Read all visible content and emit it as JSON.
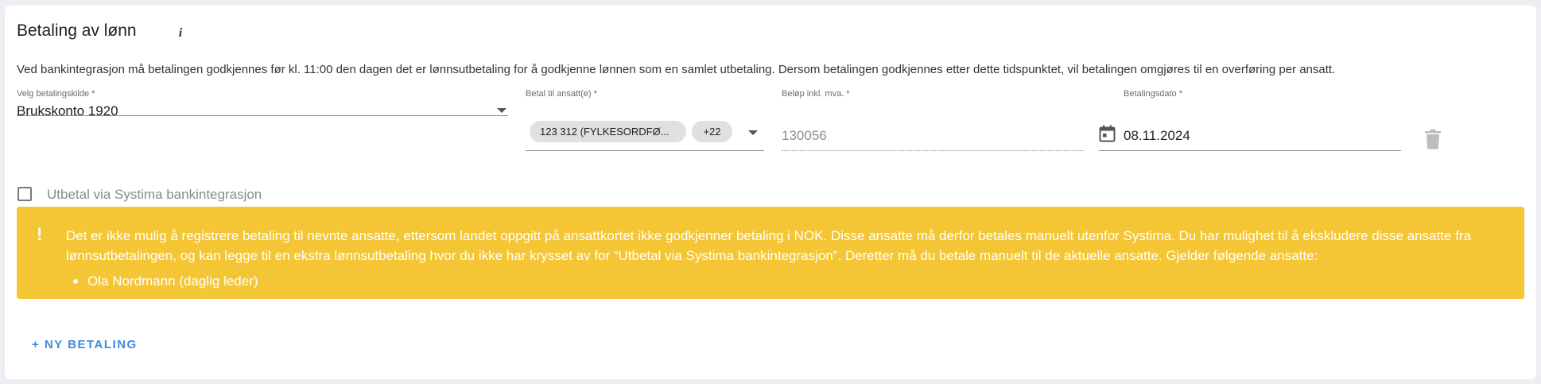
{
  "section": {
    "title": "Betaling av lønn",
    "info_icon": "info-icon",
    "description": "Ved bankintegrasjon må betalingen godkjennes før kl. 11:00 den dagen det er lønnsutbetaling for å godkjenne lønnen som en samlet utbetaling. Dersom betalingen godkjennes etter dette tidspunktet, vil betalingen omgjøres til en overføring per ansatt."
  },
  "payment_row": {
    "source": {
      "label": "Velg betalingskilde *",
      "value": "Brukskonto 1920"
    },
    "employees": {
      "label": "Betal til ansatt(e) *",
      "chip": "123 312 (FYLKESORDFØ...",
      "more": "+22"
    },
    "amount": {
      "label": "Beløp inkl. mva. *",
      "value": "130056"
    },
    "date": {
      "label": "Betalingsdato *",
      "value": "08.11.2024",
      "icon": "calendar-icon"
    },
    "delete_icon": "trash-icon"
  },
  "bank_integration": {
    "label": "Utbetal via Systima bankintegrasjon",
    "checked": false
  },
  "warning": {
    "icon": "!",
    "text": "Det er ikke mulig å registrere betaling til nevnte ansatte, ettersom landet oppgitt på ansattkortet ikke godkjenner betaling i NOK. Disse ansatte må derfor betales manuelt utenfor Systima. Du har mulighet til å ekskludere disse ansatte fra lønnsutbetalingen, og kan legge til en ekstra lønnsutbetaling hvor du ikke har krysset av for “Utbetal via Systima bankintegrasjon”. Deretter må du betale manuelt til de aktuelle ansatte. Gjelder følgende ansatte:",
    "employees": [
      "Ola Nordmann (daglig leder)"
    ],
    "background_color": "#f4c534"
  },
  "actions": {
    "add_payment": "+ NY BETALING"
  },
  "colors": {
    "accent": "#3f8ae0",
    "warning": "#f4c534"
  }
}
